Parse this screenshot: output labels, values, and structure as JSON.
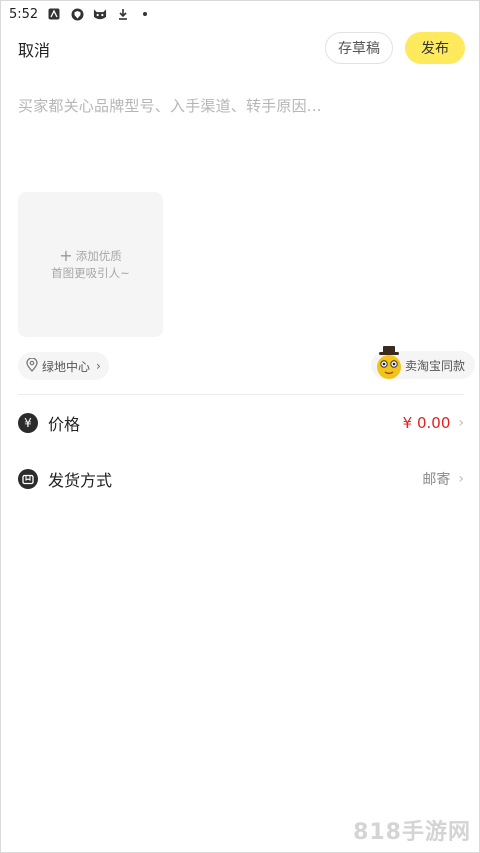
{
  "status_bar": {
    "time": "5:52"
  },
  "header": {
    "cancel_label": "取消",
    "draft_label": "存草稿",
    "publish_label": "发布"
  },
  "description": {
    "placeholder": "买家都关心品牌型号、入手渠道、转手原因..."
  },
  "photo": {
    "line1": "添加优质",
    "line2": "首图更吸引人~"
  },
  "location": {
    "label": "绿地中心"
  },
  "taobao_tag": {
    "label": "卖淘宝同款"
  },
  "price_row": {
    "icon_symbol": "¥",
    "label": "价格",
    "value": "¥ 0.00"
  },
  "shipping_row": {
    "label": "发货方式",
    "value": "邮寄"
  },
  "watermark": {
    "text": "818手游网"
  },
  "colors": {
    "publish_bg": "#ffe95c",
    "price_color": "#e02020"
  }
}
